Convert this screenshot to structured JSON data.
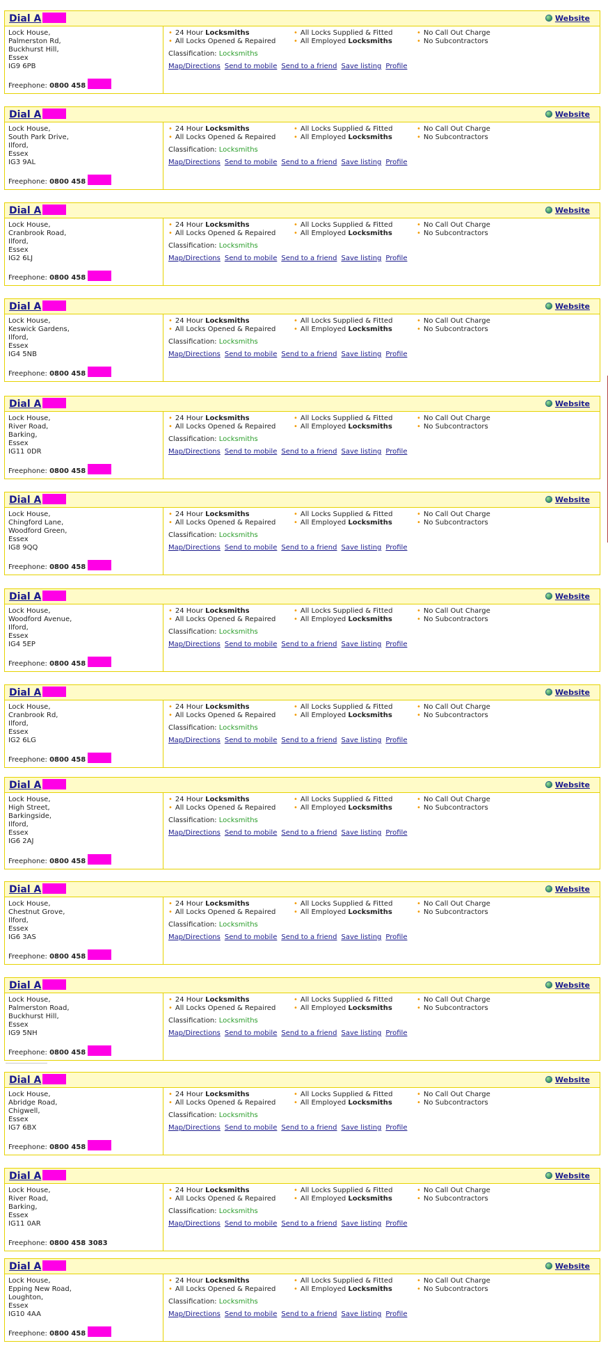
{
  "common": {
    "name_prefix": "Dial A",
    "website_label": "Website",
    "website_icon": "globe-icon",
    "freephone_label": "Freephone:",
    "feature_24_prefix": "24 Hour",
    "feature_24_bold": "Locksmiths",
    "feature_opened": "All Locks Opened & Repaired",
    "feature_supplied": "All Locks Supplied & Fitted",
    "feature_employed_prefix": "All Employed",
    "feature_employed_bold": "Locksmiths",
    "feature_no_callout": "No Call Out Charge",
    "feature_no_subcontractors": "No Subcontractors",
    "classification_label": "Classification:",
    "classification_value": "Locksmiths",
    "link_map": "Map/Directions",
    "link_mobile": "Send to mobile",
    "link_friend": "Send to a friend",
    "link_save": "Save listing",
    "link_profile": "Profile",
    "redaction_color": "#ff00e6"
  },
  "listings": [
    {
      "address": [
        "Lock House,",
        "Palmerston Rd,",
        "Buckhurst Hill,",
        "Essex",
        "IG9 6PB"
      ],
      "phone": "0800 458",
      "phone_redacted": true
    },
    {
      "address": [
        "Lock House,",
        "South Park Drive,",
        "Ilford,",
        "Essex",
        "IG3 9AL"
      ],
      "phone": "0800 458",
      "phone_redacted": true
    },
    {
      "address": [
        "Lock House,",
        "Cranbrook Road,",
        "Ilford,",
        "Essex",
        "IG2 6LJ"
      ],
      "phone": "0800 458",
      "phone_redacted": true
    },
    {
      "address": [
        "Lock House,",
        "Keswick Gardens,",
        "Ilford,",
        "Essex",
        "IG4 5NB"
      ],
      "phone": "0800 458",
      "phone_redacted": true
    },
    {
      "address": [
        "Lock House,",
        "River Road,",
        "Barking,",
        "Essex",
        "IG11 0DR"
      ],
      "phone": "0800 458",
      "phone_redacted": true
    },
    {
      "address": [
        "Lock House,",
        "Chingford Lane,",
        "Woodford Green,",
        "Essex",
        "IG8 9QQ"
      ],
      "phone": "0800 458",
      "phone_redacted": true
    },
    {
      "address": [
        "Lock House,",
        "Woodford Avenue,",
        "Ilford,",
        "Essex",
        "IG4 5EP"
      ],
      "phone": "0800 458",
      "phone_redacted": true
    },
    {
      "address": [
        "Lock House,",
        "Cranbrook Rd,",
        "Ilford,",
        "Essex",
        "IG2 6LG"
      ],
      "phone": "0800 458",
      "phone_redacted": true
    },
    {
      "address": [
        "Lock House,",
        "High Street,",
        "Barkingside,",
        "Ilford,",
        "Essex",
        "IG6 2AJ"
      ],
      "phone": "0800 458",
      "phone_redacted": true
    },
    {
      "address": [
        "Lock House,",
        "Chestnut Grove,",
        "Ilford,",
        "Essex",
        "IG6 3AS"
      ],
      "phone": "0800 458",
      "phone_redacted": true
    },
    {
      "address": [
        "Lock House,",
        "Palmerston Road,",
        "Buckhurst Hill,",
        "Essex",
        "IG9 5NH"
      ],
      "phone": "0800 458",
      "phone_redacted": true
    },
    {
      "address": [
        "Lock House,",
        "Abridge Road,",
        "Chigwell,",
        "Essex",
        "IG7 6BX"
      ],
      "phone": "0800 458",
      "phone_redacted": true
    },
    {
      "address": [
        "Lock House,",
        "River Road,",
        "Barking,",
        "Essex",
        "IG11 0AR"
      ],
      "phone": "0800 458 3083",
      "phone_redacted": false
    },
    {
      "address": [
        "Lock House,",
        "Epping New Road,",
        "Loughton,",
        "Essex",
        "IG10 4AA"
      ],
      "phone": "0800 458",
      "phone_redacted": true
    }
  ]
}
